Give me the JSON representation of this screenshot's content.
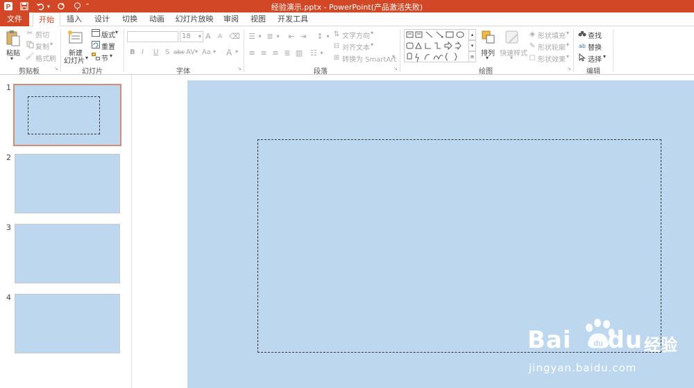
{
  "window": {
    "title": "经验演示.pptx - PowerPoint(产品激活失败)"
  },
  "quick_access": {
    "app_icon": "powerpoint-logo-icon",
    "save_icon": "save-icon",
    "undo_icon": "undo-icon",
    "redo_icon": "redo-icon",
    "touch_icon": "touch-mode-icon"
  },
  "tabs": [
    {
      "label": "文件"
    },
    {
      "label": "开始"
    },
    {
      "label": "插入"
    },
    {
      "label": "设计"
    },
    {
      "label": "切换"
    },
    {
      "label": "动画"
    },
    {
      "label": "幻灯片放映"
    },
    {
      "label": "审阅"
    },
    {
      "label": "视图"
    },
    {
      "label": "开发工具"
    }
  ],
  "ribbon": {
    "clipboard": {
      "paste": "粘贴",
      "cut": "剪切",
      "copy": "复制",
      "format_painter": "格式刷",
      "group": "剪贴板"
    },
    "slides": {
      "new_slide_1": "新建",
      "new_slide_2": "幻灯片",
      "layout": "版式",
      "reset": "重置",
      "section": "节",
      "group": "幻灯片"
    },
    "font": {
      "font_name": "",
      "font_size": "18",
      "bold": "B",
      "italic": "I",
      "underline": "U",
      "strike": "S",
      "spacing": "abc",
      "case": "Aa",
      "clear": "A",
      "grow": "A",
      "shrink": "A",
      "color": "A",
      "spacing2": "AV",
      "group": "字体"
    },
    "paragraph": {
      "text_direction": "文字方向",
      "align_text": "对齐文本",
      "smartart": "转换为 SmartArt",
      "group": "段落"
    },
    "drawing": {
      "arrange": "排列",
      "quick_styles": "快速样式",
      "shape_fill": "形状填充",
      "shape_outline": "形状轮廓",
      "shape_effects": "形状效果",
      "group": "绘图"
    },
    "editing": {
      "find": "查找",
      "replace": "替换",
      "select": "选择",
      "group": "编辑"
    }
  },
  "thumbnails": [
    {
      "num": "1"
    },
    {
      "num": "2"
    },
    {
      "num": "3"
    },
    {
      "num": "4"
    }
  ],
  "watermark": {
    "brand": "Bai",
    "brand2": "du",
    "cn": "经验",
    "url": "jingyan.baidu.com"
  },
  "colors": {
    "accent": "#d24726",
    "slide_bg": "#bdd7ee"
  }
}
